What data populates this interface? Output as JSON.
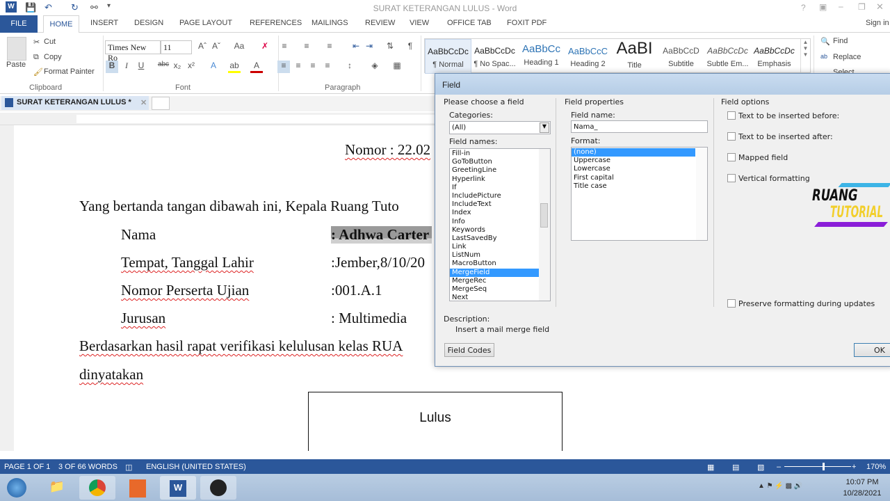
{
  "window": {
    "title": "SURAT KETERANGAN LULUS - Word",
    "sign_in": "Sign in"
  },
  "quick_access": [
    "word-icon",
    "save-icon",
    "undo-icon",
    "redo-icon",
    "print-preview-icon",
    "customize-icon"
  ],
  "tabs": [
    "FILE",
    "HOME",
    "INSERT",
    "DESIGN",
    "PAGE LAYOUT",
    "REFERENCES",
    "MAILINGS",
    "REVIEW",
    "VIEW",
    "OFFICE TAB",
    "FOXIT PDF"
  ],
  "ribbon": {
    "clipboard": {
      "label": "Clipboard",
      "paste": "Paste",
      "cut": "Cut",
      "copy": "Copy",
      "format_painter": "Format Painter"
    },
    "font": {
      "label": "Font",
      "font_name": "Times New Ro",
      "font_size": "11"
    },
    "paragraph": {
      "label": "Paragraph"
    },
    "styles": [
      {
        "preview": "AaBbCcDc",
        "name": "¶ Normal"
      },
      {
        "preview": "AaBbCcDc",
        "name": "¶ No Spac..."
      },
      {
        "preview": "AaBbCc",
        "name": "Heading 1"
      },
      {
        "preview": "AaBbCcC",
        "name": "Heading 2"
      },
      {
        "preview": "AaBI",
        "name": "Title"
      },
      {
        "preview": "AaBbCcD",
        "name": "Subtitle"
      },
      {
        "preview": "AaBbCcDc",
        "name": "Subtle Em..."
      },
      {
        "preview": "AaBbCcDc",
        "name": "Emphasis"
      }
    ],
    "editing": {
      "find": "Find",
      "replace": "Replace",
      "select": "Select"
    }
  },
  "doc_tab": "SURAT KETERANGAN LULUS *",
  "document": {
    "nomor": "Nomor : 22.02",
    "intro": "Yang bertanda tangan dibawah ini, Kepala Ruang Tuto",
    "rows": [
      {
        "label": "Nama",
        "value": ": Adhwa Carter"
      },
      {
        "label": "Tempat, Tanggal Lahir",
        "value": ":Jember,8/10/20"
      },
      {
        "label": "Nomor Perserta Ujian",
        "value": ":001.A.1"
      },
      {
        "label": "Jurusan",
        "value": ": Multimedia"
      }
    ],
    "para": "Berdasarkan hasil rapat verifikasi kelulusan kelas RUA",
    "para2": "dinyatakan",
    "box": "Lulus"
  },
  "dialog": {
    "title": "Field",
    "choose": "Please choose a field",
    "categories_label": "Categories:",
    "categories_value": "(All)",
    "field_names_label": "Field names:",
    "field_names": [
      "Fill-in",
      "GoToButton",
      "GreetingLine",
      "Hyperlink",
      "If",
      "IncludePicture",
      "IncludeText",
      "Index",
      "Info",
      "Keywords",
      "LastSavedBy",
      "Link",
      "ListNum",
      "MacroButton",
      "MergeField",
      "MergeRec",
      "MergeSeq",
      "Next"
    ],
    "selected_field": "MergeField",
    "properties": "Field properties",
    "field_name_label": "Field name:",
    "field_name_value": "Nama_",
    "format_label": "Format:",
    "formats": [
      "(none)",
      "Uppercase",
      "Lowercase",
      "First capital",
      "Title case"
    ],
    "selected_format": "(none)",
    "options": "Field options",
    "option_items": [
      {
        "label": "Text to be inserted before:",
        "checked": false
      },
      {
        "label": "Text to be inserted after:",
        "checked": false
      },
      {
        "label": "Mapped field",
        "checked": false
      },
      {
        "label": "Vertical formatting",
        "checked": false
      }
    ],
    "preserve": "Preserve formatting during updates",
    "description_label": "Description:",
    "description": "Insert a mail merge field",
    "field_codes": "Field Codes",
    "ok": "OK",
    "watermark": "RUANG TUTORIAL"
  },
  "status": {
    "page": "PAGE 1 OF 1",
    "words": "3 OF 66 WORDS",
    "language": "ENGLISH (UNITED STATES)",
    "zoom": "170%",
    "zoom_percent": 170
  },
  "taskbar": {
    "time": "10:07 PM",
    "date": "10/28/2021"
  }
}
